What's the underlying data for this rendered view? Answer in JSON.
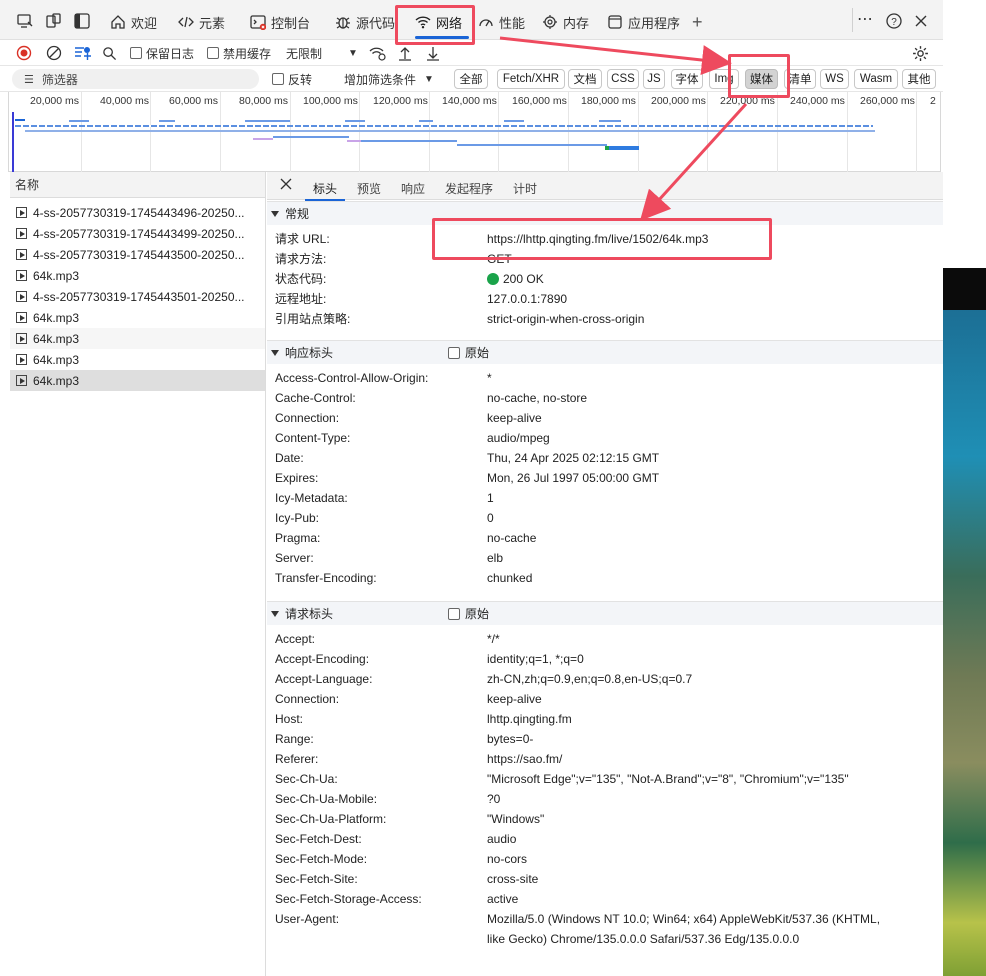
{
  "tabs": [
    {
      "label": "欢迎",
      "icon": "home-icon"
    },
    {
      "label": "元素",
      "icon": "code-icon"
    },
    {
      "label": "控制台",
      "icon": "console-icon"
    },
    {
      "label": "源代码",
      "icon": "bug-icon"
    },
    {
      "label": "网络",
      "icon": "wifi-icon"
    },
    {
      "label": "性能",
      "icon": "performance-icon"
    },
    {
      "label": "内存",
      "icon": "memory-icon"
    },
    {
      "label": "应用程序",
      "icon": "application-icon"
    }
  ],
  "toolbar": {
    "preserve_log": "保留日志",
    "disable_cache": "禁用缓存",
    "throttle": "无限制"
  },
  "filter": {
    "placeholder": "筛选器",
    "invert": "反转",
    "more_filters": "增加筛选条件",
    "chips": [
      "全部",
      "Fetch/XHR",
      "文档",
      "CSS",
      "JS",
      "字体",
      "Img",
      "媒体",
      "清单",
      "WS",
      "Wasm",
      "其他"
    ],
    "selected_chip": "媒体"
  },
  "overview": {
    "ticks": [
      "20,000 ms",
      "40,000 ms",
      "60,000 ms",
      "80,000 ms",
      "100,000 ms",
      "120,000 ms",
      "140,000 ms",
      "160,000 ms",
      "180,000 ms",
      "200,000 ms",
      "220,000 ms",
      "240,000 ms",
      "260,000 ms",
      "2"
    ]
  },
  "requests": {
    "header": "名称",
    "items": [
      "4-ss-2057730319-1745443496-20250...",
      "4-ss-2057730319-1745443499-20250...",
      "4-ss-2057730319-1745443500-20250...",
      "64k.mp3",
      "4-ss-2057730319-1745443501-20250...",
      "64k.mp3",
      "64k.mp3",
      "64k.mp3",
      "64k.mp3"
    ]
  },
  "detail_tabs": [
    "标头",
    "预览",
    "响应",
    "发起程序",
    "计时"
  ],
  "general": {
    "title": "常规",
    "rows": [
      {
        "k": "请求 URL:",
        "v": "https://lhttp.qingting.fm/live/1502/64k.mp3"
      },
      {
        "k": "请求方法:",
        "v": "GET"
      },
      {
        "k": "状态代码:",
        "v": "200 OK"
      },
      {
        "k": "远程地址:",
        "v": "127.0.0.1:7890"
      },
      {
        "k": "引用站点策略:",
        "v": "strict-origin-when-cross-origin"
      }
    ]
  },
  "response_headers": {
    "title": "响应标头",
    "raw": "原始",
    "rows": [
      {
        "k": "Access-Control-Allow-Origin:",
        "v": "*"
      },
      {
        "k": "Cache-Control:",
        "v": "no-cache, no-store"
      },
      {
        "k": "Connection:",
        "v": "keep-alive"
      },
      {
        "k": "Content-Type:",
        "v": "audio/mpeg"
      },
      {
        "k": "Date:",
        "v": "Thu, 24 Apr 2025 02:12:15 GMT"
      },
      {
        "k": "Expires:",
        "v": "Mon, 26 Jul 1997 05:00:00 GMT"
      },
      {
        "k": "Icy-Metadata:",
        "v": "1"
      },
      {
        "k": "Icy-Pub:",
        "v": "0"
      },
      {
        "k": "Pragma:",
        "v": "no-cache"
      },
      {
        "k": "Server:",
        "v": "elb"
      },
      {
        "k": "Transfer-Encoding:",
        "v": "chunked"
      }
    ]
  },
  "request_headers": {
    "title": "请求标头",
    "raw": "原始",
    "rows": [
      {
        "k": "Accept:",
        "v": "*/*"
      },
      {
        "k": "Accept-Encoding:",
        "v": "identity;q=1, *;q=0"
      },
      {
        "k": "Accept-Language:",
        "v": "zh-CN,zh;q=0.9,en;q=0.8,en-US;q=0.7"
      },
      {
        "k": "Connection:",
        "v": "keep-alive"
      },
      {
        "k": "Host:",
        "v": "lhttp.qingting.fm"
      },
      {
        "k": "Range:",
        "v": "bytes=0-"
      },
      {
        "k": "Referer:",
        "v": "https://sao.fm/"
      },
      {
        "k": "Sec-Ch-Ua:",
        "v": "\"Microsoft Edge\";v=\"135\", \"Not-A.Brand\";v=\"8\", \"Chromium\";v=\"135\""
      },
      {
        "k": "Sec-Ch-Ua-Mobile:",
        "v": "?0"
      },
      {
        "k": "Sec-Ch-Ua-Platform:",
        "v": "\"Windows\""
      },
      {
        "k": "Sec-Fetch-Dest:",
        "v": "audio"
      },
      {
        "k": "Sec-Fetch-Mode:",
        "v": "no-cors"
      },
      {
        "k": "Sec-Fetch-Site:",
        "v": "cross-site"
      },
      {
        "k": "Sec-Fetch-Storage-Access:",
        "v": "active"
      },
      {
        "k": "User-Agent:",
        "v": "Mozilla/5.0 (Windows NT 10.0; Win64; x64) AppleWebKit/537.36 (KHTML,"
      },
      {
        "k": "",
        "v": "like Gecko) Chrome/135.0.0.0 Safari/537.36 Edg/135.0.0.0"
      }
    ]
  },
  "colors": {
    "accent": "#1a64d6",
    "annotation": "#ee4a5e",
    "status_ok": "#1aa34a",
    "selected_chip_bg": "#d3d3d3"
  }
}
